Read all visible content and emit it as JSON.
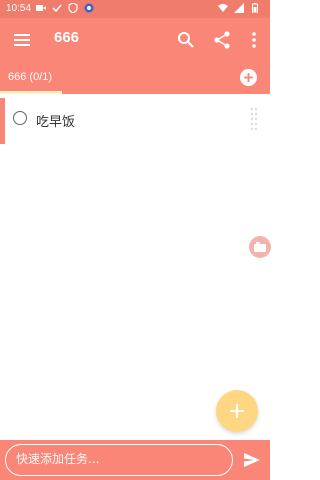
{
  "status_bar": {
    "time": "10:54"
  },
  "app_bar": {
    "title": "666"
  },
  "tabs": [
    {
      "label": "666 (0/1)",
      "selected": true
    }
  ],
  "tasks": [
    {
      "label": "吃早饭",
      "checked": false
    }
  ],
  "quick_add": {
    "placeholder": "快速添加任务..."
  },
  "colors": {
    "primary": "#fa8677",
    "status_bar": "#f07c6c",
    "fab": "#ffd783",
    "tab_indicator": "#fff1c6"
  },
  "icons": {
    "menu": "menu-icon",
    "search": "search-icon",
    "share": "share-icon",
    "more": "more-vert-icon",
    "add_list": "add-circle-icon",
    "drag": "drag-handle-icon",
    "side": "side-action-icon",
    "fab": "add-icon",
    "send": "send-icon"
  }
}
